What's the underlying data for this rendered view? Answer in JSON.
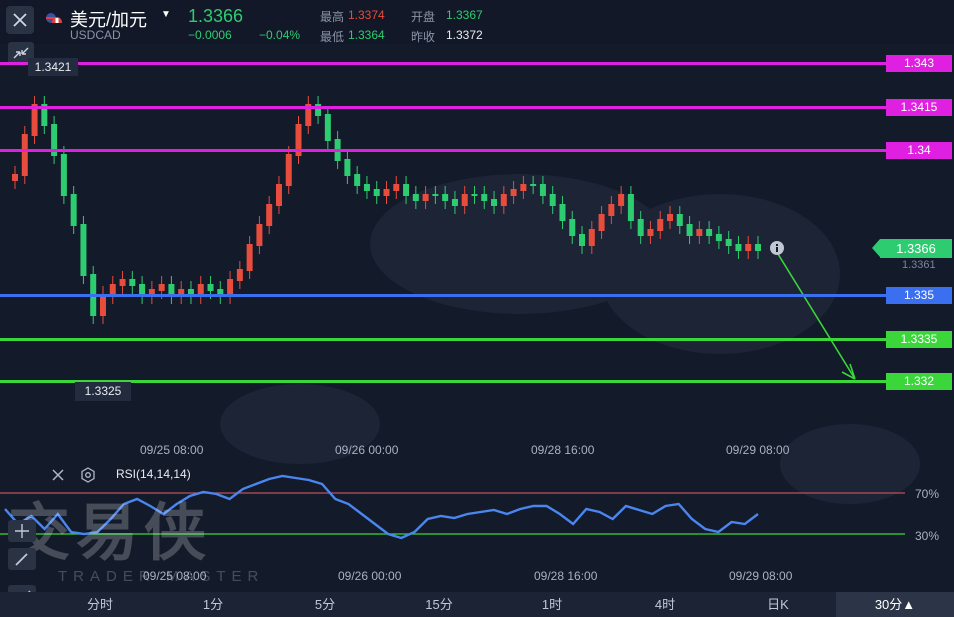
{
  "header": {
    "title": "美元/加元",
    "subtitle": "USDCAD",
    "price": "1.3366",
    "change": "−0.0006",
    "change_pct": "−0.04%",
    "high_label": "最高",
    "high_value": "1.3374",
    "open_label": "开盘",
    "open_value": "1.3367",
    "low_label": "最低",
    "low_value": "1.3364",
    "prev_label": "昨收",
    "prev_value": "1.3372"
  },
  "chart": {
    "high_marker": "1.3421",
    "low_marker": "1.3325",
    "current_price_tag": "1.3366",
    "current_price_sub": "1.3361",
    "lines": [
      {
        "label": "1.343",
        "color": "#e020e0"
      },
      {
        "label": "1.3415",
        "color": "#e020e0"
      },
      {
        "label": "1.34",
        "color": "#e020e0"
      },
      {
        "label": "1.335",
        "color": "#3a6ff0"
      },
      {
        "label": "1.3335",
        "color": "#3ad63a"
      },
      {
        "label": "1.332",
        "color": "#3ad63a"
      }
    ],
    "time_labels": [
      "09/25 08:00",
      "09/26 00:00",
      "09/28 16:00",
      "09/29 08:00"
    ]
  },
  "rsi": {
    "label": "RSI(14,14,14)",
    "level_70": "70%",
    "level_30": "30%",
    "time_labels": [
      "09/25 08:00",
      "09/26 00:00",
      "09/28 16:00",
      "09/29 08:00"
    ]
  },
  "watermark": {
    "main": "交易侠",
    "sub": "TRADER MASTER"
  },
  "timeframes": [
    "分时",
    "1分",
    "5分",
    "15分",
    "1时",
    "4时",
    "日K"
  ],
  "timeframe_selected": "30分▲",
  "colors": {
    "up": "#e74c3c",
    "down": "#2ecc71",
    "rsi": "#4a86f0"
  }
}
